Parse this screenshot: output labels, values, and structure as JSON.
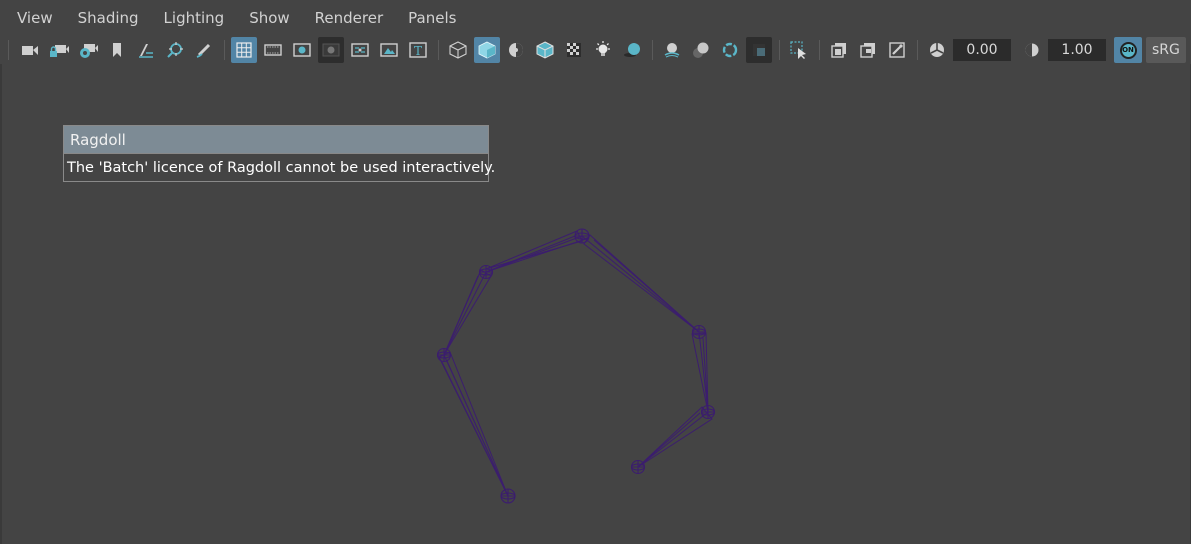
{
  "menubar": {
    "items": [
      "View",
      "Shading",
      "Lighting",
      "Show",
      "Renderer",
      "Panels"
    ]
  },
  "toolbar": {
    "exposure_value": "0.00",
    "gamma_value": "1.00",
    "color_mgmt_toggle": "ON",
    "color_space": "sRG"
  },
  "dialog": {
    "title": "Ragdoll",
    "message": "The 'Batch' licence of Ragdoll cannot be used interactively."
  },
  "colors": {
    "viewport_bg": "#444444",
    "accent": "#5285a6",
    "dialog_title_bg": "#7d8b95",
    "bone_wire": "#3b1d6e"
  },
  "icons": [
    "camera-icon",
    "camera-lock-icon",
    "camera-attributes-icon",
    "bookmark-icon",
    "image-plane-icon",
    "2d-pan-zoom-icon",
    "grease-pencil-icon",
    "grid-icon",
    "film-gate-icon",
    "resolution-gate-icon",
    "gate-mask-icon",
    "field-chart-icon",
    "safe-action-icon",
    "safe-title-icon",
    "wireframe-icon",
    "smooth-shade-icon",
    "default-material-icon",
    "wireframe-on-shaded-icon",
    "xray-icon",
    "use-lights-icon",
    "shadows-icon",
    "screen-space-ao-icon",
    "motion-blur-icon",
    "anti-aliasing-icon",
    "depth-of-field-icon",
    "isolate-select-icon",
    "xray-joints-icon",
    "xray-active-icon",
    "backface-culling-icon",
    "exposure-icon",
    "gamma-icon"
  ]
}
